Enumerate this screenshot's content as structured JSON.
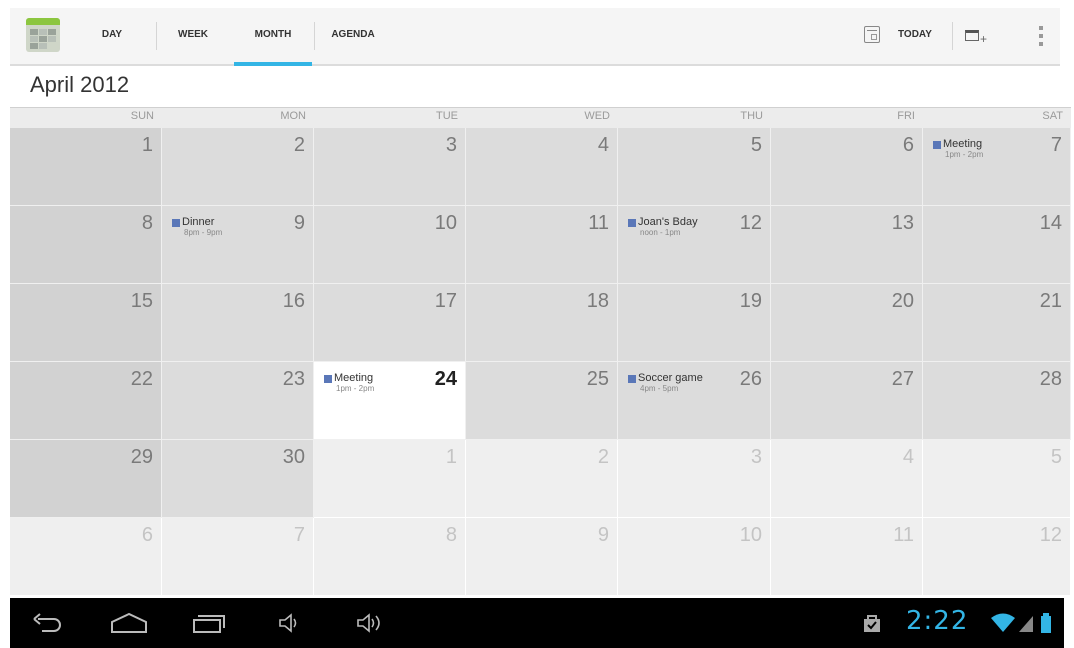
{
  "toolbar": {
    "tabs": [
      {
        "label": "DAY",
        "selected": false
      },
      {
        "label": "WEEK",
        "selected": false
      },
      {
        "label": "MONTH",
        "selected": true
      },
      {
        "label": "AGENDA",
        "selected": false
      }
    ],
    "today_label": "TODAY",
    "accent_color": "#33b5e5"
  },
  "month_title": "April 2012",
  "weekdays": [
    "SUN",
    "MON",
    "TUE",
    "WED",
    "THU",
    "FRI",
    "SAT"
  ],
  "weeks": [
    [
      {
        "day": "1",
        "in_month": true
      },
      {
        "day": "2",
        "in_month": true
      },
      {
        "day": "3",
        "in_month": true
      },
      {
        "day": "4",
        "in_month": true
      },
      {
        "day": "5",
        "in_month": true
      },
      {
        "day": "6",
        "in_month": true
      },
      {
        "day": "7",
        "in_month": true,
        "event": {
          "title": "Meeting",
          "time": "1pm - 2pm"
        }
      }
    ],
    [
      {
        "day": "8",
        "in_month": true
      },
      {
        "day": "9",
        "in_month": true,
        "event": {
          "title": "Dinner",
          "time": "8pm - 9pm"
        }
      },
      {
        "day": "10",
        "in_month": true
      },
      {
        "day": "11",
        "in_month": true
      },
      {
        "day": "12",
        "in_month": true,
        "event": {
          "title": "Joan's Bday",
          "time": "noon - 1pm"
        }
      },
      {
        "day": "13",
        "in_month": true
      },
      {
        "day": "14",
        "in_month": true
      }
    ],
    [
      {
        "day": "15",
        "in_month": true
      },
      {
        "day": "16",
        "in_month": true
      },
      {
        "day": "17",
        "in_month": true
      },
      {
        "day": "18",
        "in_month": true
      },
      {
        "day": "19",
        "in_month": true
      },
      {
        "day": "20",
        "in_month": true
      },
      {
        "day": "21",
        "in_month": true
      }
    ],
    [
      {
        "day": "22",
        "in_month": true
      },
      {
        "day": "23",
        "in_month": true
      },
      {
        "day": "24",
        "in_month": true,
        "today": true,
        "event": {
          "title": "Meeting",
          "time": "1pm - 2pm"
        }
      },
      {
        "day": "25",
        "in_month": true
      },
      {
        "day": "26",
        "in_month": true,
        "event": {
          "title": "Soccer game",
          "time": "4pm - 5pm"
        }
      },
      {
        "day": "27",
        "in_month": true
      },
      {
        "day": "28",
        "in_month": true
      }
    ],
    [
      {
        "day": "29",
        "in_month": true
      },
      {
        "day": "30",
        "in_month": true
      },
      {
        "day": "1",
        "in_month": false
      },
      {
        "day": "2",
        "in_month": false
      },
      {
        "day": "3",
        "in_month": false
      },
      {
        "day": "4",
        "in_month": false
      },
      {
        "day": "5",
        "in_month": false
      }
    ],
    [
      {
        "day": "6",
        "in_month": false
      },
      {
        "day": "7",
        "in_month": false
      },
      {
        "day": "8",
        "in_month": false
      },
      {
        "day": "9",
        "in_month": false
      },
      {
        "day": "10",
        "in_month": false
      },
      {
        "day": "11",
        "in_month": false
      },
      {
        "day": "12",
        "in_month": false
      }
    ]
  ],
  "event_color": "#5a77b8",
  "navbar": {
    "clock": "2:22",
    "icons": [
      "back-icon",
      "home-icon",
      "recents-icon",
      "volume-down-icon",
      "volume-up-icon",
      "shopping-bag-icon",
      "wifi-icon",
      "signal-icon",
      "battery-icon"
    ]
  }
}
